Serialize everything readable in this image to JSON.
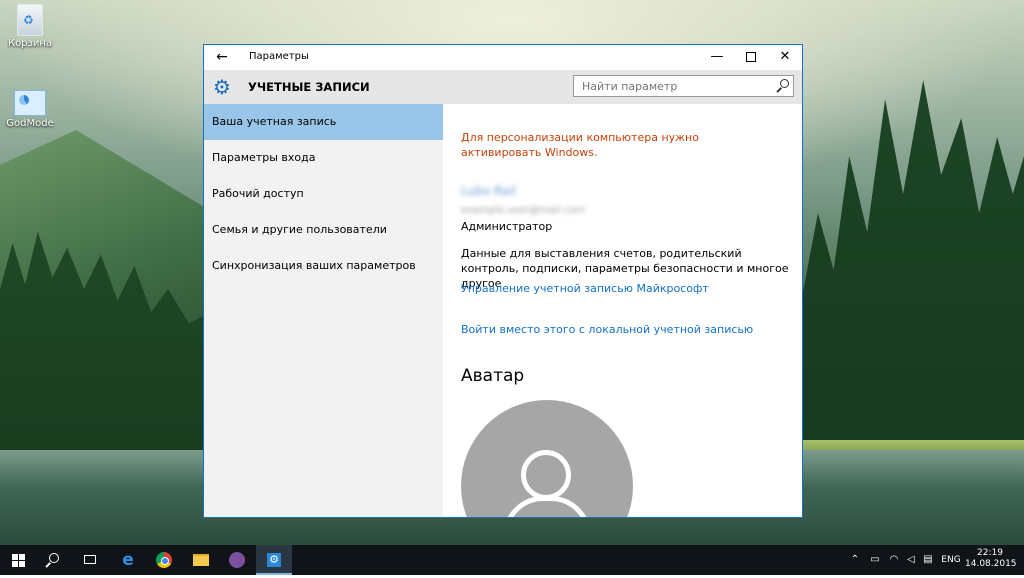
{
  "desktop": {
    "icons": [
      {
        "label": "Корзина"
      },
      {
        "label": "GodMode"
      }
    ]
  },
  "window": {
    "app_title": "Параметры",
    "back_glyph": "←",
    "min_glyph": "—",
    "close_glyph": "✕",
    "accent_color": "#1b6fbf"
  },
  "header": {
    "icon": "gear-icon",
    "title": "УЧЕТНЫЕ ЗАПИСИ",
    "search_placeholder": "Найти параметр"
  },
  "sidebar": {
    "items": [
      {
        "label": "Ваша учетная запись",
        "selected": true
      },
      {
        "label": "Параметры входа",
        "selected": false
      },
      {
        "label": "Рабочий доступ",
        "selected": false
      },
      {
        "label": "Семья и другие пользователи",
        "selected": false
      },
      {
        "label": "Синхронизация ваших параметров",
        "selected": false
      }
    ],
    "selected_color": "#99c6e8"
  },
  "content": {
    "activation_warning": "Для персонализации компьютера нужно активировать Windows.",
    "warning_color": "#c8420a",
    "user_name": "Lubo Rail",
    "user_email": "example.user@mail.com",
    "user_role": "Администратор",
    "account_desc": "Данные для выставления счетов, родительский контроль, подписки, параметры безопасности и многое другое",
    "link_manage": "Управление учетной записью Майкрософт",
    "link_local": "Войти вместо этого с локальной учетной записью",
    "link_color": "#1370c9",
    "avatar_heading": "Аватар"
  },
  "taskbar": {
    "tray": {
      "language": "ENG",
      "time": "22:19",
      "date": "14.08.2015"
    }
  }
}
